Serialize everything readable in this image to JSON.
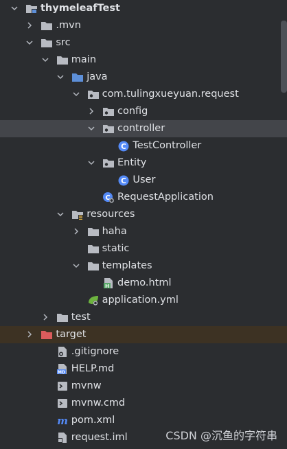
{
  "tree": {
    "nodes": [
      {
        "label": "thymeleafTest",
        "depth": 0,
        "arrow": "down",
        "icon": "folder-module-icon",
        "bold": true
      },
      {
        "label": ".mvn",
        "depth": 1,
        "arrow": "right",
        "icon": "folder-icon"
      },
      {
        "label": "src",
        "depth": 1,
        "arrow": "down",
        "icon": "folder-icon"
      },
      {
        "label": "main",
        "depth": 2,
        "arrow": "down",
        "icon": "folder-icon"
      },
      {
        "label": "java",
        "depth": 3,
        "arrow": "down",
        "icon": "source-folder-icon"
      },
      {
        "label": "com.tulingxueyuan.request",
        "depth": 4,
        "arrow": "down",
        "icon": "package-icon"
      },
      {
        "label": "config",
        "depth": 5,
        "arrow": "right",
        "icon": "package-icon"
      },
      {
        "label": "controller",
        "depth": 5,
        "arrow": "down",
        "icon": "package-icon",
        "state": "selected"
      },
      {
        "label": "TestController",
        "depth": 6,
        "arrow": "none",
        "icon": "java-class-icon"
      },
      {
        "label": "Entity",
        "depth": 5,
        "arrow": "down",
        "icon": "package-icon"
      },
      {
        "label": "User",
        "depth": 6,
        "arrow": "none",
        "icon": "java-class-icon"
      },
      {
        "label": "RequestApplication",
        "depth": 5,
        "arrow": "none",
        "icon": "spring-boot-class-icon"
      },
      {
        "label": "resources",
        "depth": 3,
        "arrow": "down",
        "icon": "resources-folder-icon"
      },
      {
        "label": "haha",
        "depth": 4,
        "arrow": "right",
        "icon": "folder-icon"
      },
      {
        "label": "static",
        "depth": 4,
        "arrow": "none",
        "icon": "folder-icon"
      },
      {
        "label": "templates",
        "depth": 4,
        "arrow": "down",
        "icon": "folder-icon"
      },
      {
        "label": "demo.html",
        "depth": 5,
        "arrow": "none",
        "icon": "html-file-icon"
      },
      {
        "label": "application.yml",
        "depth": 4,
        "arrow": "none",
        "icon": "yaml-config-icon"
      },
      {
        "label": "test",
        "depth": 2,
        "arrow": "right",
        "icon": "folder-icon"
      },
      {
        "label": "target",
        "depth": 1,
        "arrow": "right",
        "icon": "excluded-folder-icon",
        "state": "excluded"
      },
      {
        "label": ".gitignore",
        "depth": 2,
        "arrow": "none",
        "icon": "gitignore-file-icon"
      },
      {
        "label": "HELP.md",
        "depth": 2,
        "arrow": "none",
        "icon": "markdown-file-icon"
      },
      {
        "label": "mvnw",
        "depth": 2,
        "arrow": "none",
        "icon": "shell-script-icon"
      },
      {
        "label": "mvnw.cmd",
        "depth": 2,
        "arrow": "none",
        "icon": "shell-script-icon"
      },
      {
        "label": "pom.xml",
        "depth": 2,
        "arrow": "none",
        "icon": "maven-file-icon"
      },
      {
        "label": "request.iml",
        "depth": 2,
        "arrow": "none",
        "icon": "iml-file-icon"
      }
    ]
  },
  "watermark": "CSDN @沉鱼的字符串",
  "colors": {
    "background": "#2b2d30",
    "selection": "#43454a",
    "excluded_row": "#3d3223",
    "text": "#dfe1e5",
    "folder": "#b8bbc2",
    "source_folder": "#5d8fd8",
    "excluded_folder": "#db5c5c",
    "java_class": "#548af7"
  }
}
